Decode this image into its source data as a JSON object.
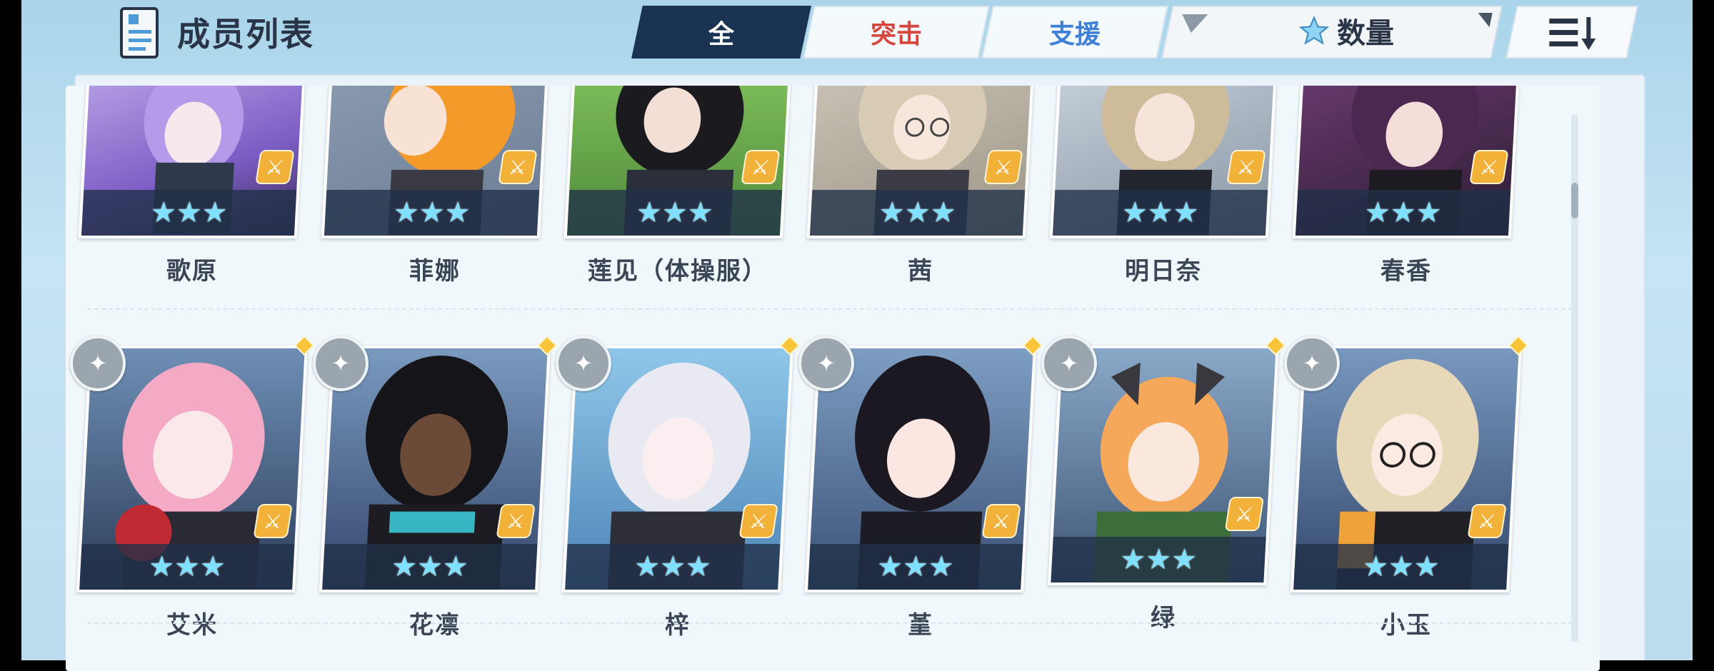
{
  "header": {
    "title": "成员列表",
    "tabs": [
      {
        "label": "全",
        "selected": true,
        "color": "#ffffff"
      },
      {
        "label": "突击",
        "selected": false,
        "color": "#d6463f"
      },
      {
        "label": "支援",
        "selected": false,
        "color": "#3f7fd6"
      }
    ],
    "filter_icon": "filter-funnel-icon",
    "sort": {
      "label": "数量",
      "icon": "star-icon"
    },
    "sort_order_icon": "sort-descending-icon"
  },
  "colors": {
    "accent": "#1b3352",
    "striker": "#d6463f",
    "special": "#3f7fd6",
    "star": "#7fe0ff",
    "role_badge": "#f2b23a"
  },
  "members": {
    "row1": [
      {
        "name": "歌原",
        "stars": "★★★",
        "role": "⚔"
      },
      {
        "name": "菲娜",
        "stars": "★★★",
        "role": "⚔"
      },
      {
        "name": "莲见（体操服）",
        "stars": "★★★",
        "role": "⚔"
      },
      {
        "name": "茜",
        "stars": "★★★",
        "role": "⚔"
      },
      {
        "name": "明日奈",
        "stars": "★★★",
        "role": "⚔"
      },
      {
        "name": "春香",
        "stars": "★★★",
        "role": "⚔"
      }
    ],
    "row2": [
      {
        "name": "艾米",
        "stars": "★★★",
        "role": "⚔"
      },
      {
        "name": "花凛",
        "stars": "★★★",
        "role": "⚔"
      },
      {
        "name": "梓",
        "stars": "★★★",
        "role": "⚔"
      },
      {
        "name": "堇",
        "stars": "★★★",
        "role": "⚔"
      },
      {
        "name": "绿",
        "stars": "★★★",
        "role": "⚔"
      },
      {
        "name": "小玉",
        "stars": "★★★",
        "role": "⚔"
      }
    ]
  }
}
